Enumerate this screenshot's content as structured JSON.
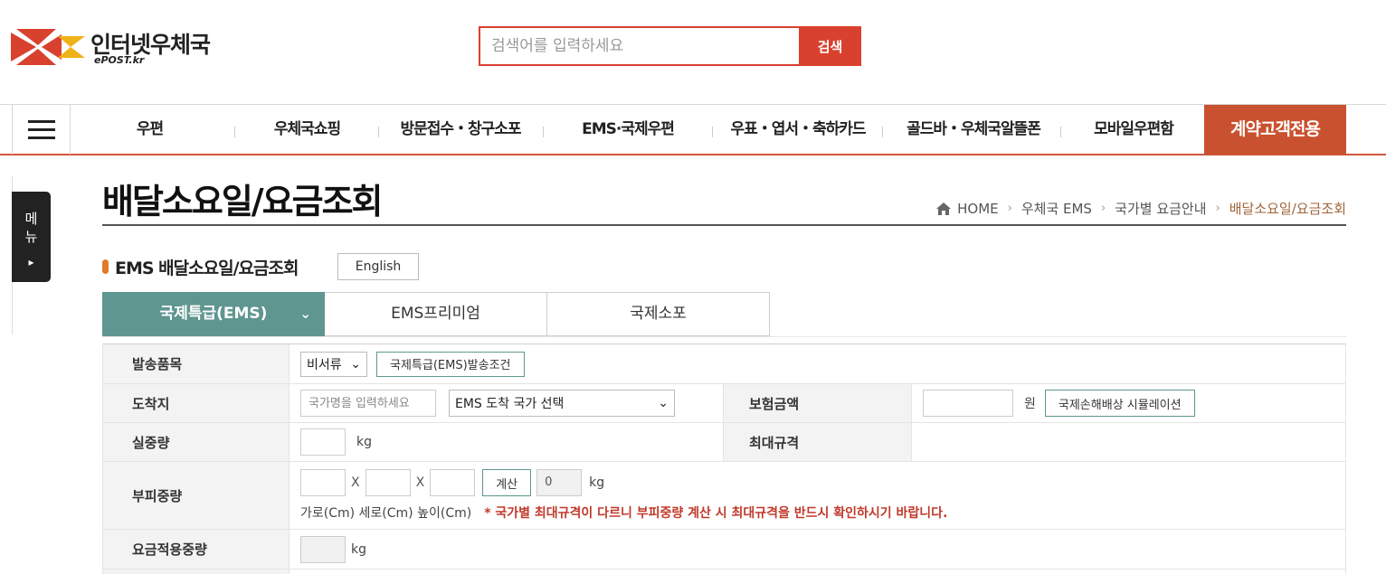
{
  "header": {
    "logo_title": "인터넷우체국",
    "logo_sub": "ePOST.kr",
    "search_placeholder": "검색어를 입력하세요",
    "search_button": "검색"
  },
  "nav": {
    "items": [
      "우편",
      "우체국쇼핑",
      "방문접수・창구소포",
      "EMS·국제우편",
      "우표・엽서・축하카드",
      "골드바・우체국알뜰폰",
      "모바일우편함"
    ],
    "contract": "계약고객전용"
  },
  "side_menu": {
    "label_1": "메",
    "label_2": "뉴",
    "arrow": "▸"
  },
  "page": {
    "title": "배달소요일/요금조회",
    "breadcrumb": [
      "HOME",
      "우체국 EMS",
      "국가별 요금안내",
      "배달소요일/요금조회"
    ],
    "section_title": "EMS 배달소요일/요금조회",
    "english_button": "English"
  },
  "tabs": [
    {
      "label": "국제특급(EMS)",
      "active": true
    },
    {
      "label": "EMS프리미엄",
      "active": false
    },
    {
      "label": "국제소포",
      "active": false
    }
  ],
  "form": {
    "item_label": "발송품목",
    "item_value": "비서류",
    "item_button": "국제특급(EMS)발송조건",
    "dest_label": "도착지",
    "dest_placeholder": "국가명을 입력하세요",
    "dest_select": "EMS 도착 국가 선택",
    "insurance_label": "보험금액",
    "insurance_unit": "원",
    "insurance_button": "국제손해배상 시뮬레이션",
    "weight_label": "실중량",
    "weight_unit": "kg",
    "maxsize_label": "최대규격",
    "volume_label": "부피중량",
    "x_mark": "X",
    "calc_button": "계산",
    "volume_result": "0",
    "volume_unit": "kg",
    "dims_caption": "가로(Cm) 세로(Cm) 높이(Cm)",
    "volume_warning": "* 국가별 최대규격이 다르니 부피중량 계산 시 최대규격을 반드시 확인하시기 바랍니다.",
    "applied_label": "요금적용중량",
    "applied_unit": "kg"
  },
  "colors": {
    "brand_red": "#d9412f",
    "contract_orange": "#c9512f",
    "tab_teal": "#5f9690",
    "warning_red": "#c0392b"
  },
  "icons": [
    "epost-logo-icon",
    "hamburger-icon",
    "home-icon",
    "chevron-down-icon",
    "chevron-right-icon"
  ]
}
